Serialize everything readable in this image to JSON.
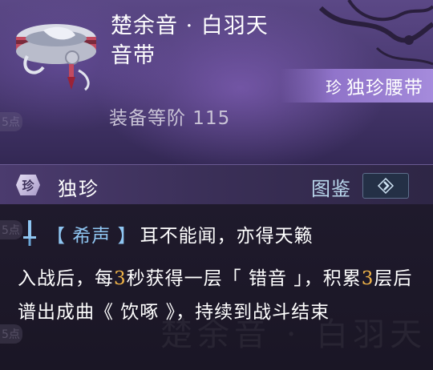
{
  "item": {
    "name_line1": "楚余音 · 白羽天",
    "name_line2": "音带",
    "rarity_gem": "珍",
    "rarity_type": "独珍腰带",
    "equip_level_label": "装备等阶 115"
  },
  "side_tabs": [
    "5点",
    "5点",
    "5点",
    "5点"
  ],
  "rarity_bar": {
    "gem": "珍",
    "label": "独珍",
    "codex_label": "图鉴"
  },
  "skill": {
    "name": "【 希声 】",
    "subtitle": "耳不能闻，亦得天籁",
    "desc_parts": [
      {
        "t": "入战后，每"
      },
      {
        "t": "3",
        "hl": true
      },
      {
        "t": "秒获得一层「 错音 」，积累"
      },
      {
        "t": "3",
        "hl": true
      },
      {
        "t": "层后谱出成曲《 饮啄 》，持续到战斗结束"
      }
    ]
  },
  "watermark": "楚余音 · 白羽天",
  "colors": {
    "accent_blue": "#8fc6f2",
    "highlight_number": "#f0b448",
    "ribbon_purple": "#a58bdc"
  }
}
